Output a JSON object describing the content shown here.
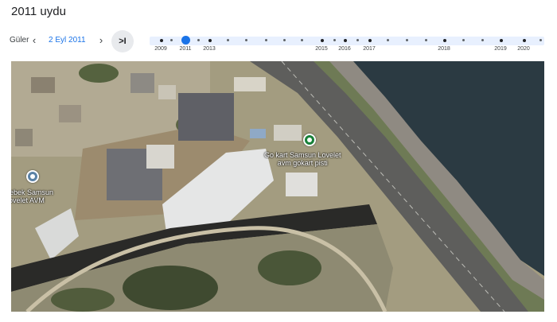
{
  "page": {
    "title": "2011 uydu"
  },
  "toolbar": {
    "cut_label": "Güler",
    "prev_icon": "‹",
    "date": "2 Eyl 2011",
    "next_icon": "›",
    "latest_icon": ">I"
  },
  "timeline": {
    "years": [
      "2009",
      "2011",
      "2013",
      "2015",
      "2016",
      "2017",
      "2018",
      "2019",
      "2020"
    ],
    "selected_year": "2011"
  },
  "map": {
    "pois": [
      {
        "id": "gokart",
        "line1": "Go kart Samsun Lovelet",
        "line2": "avm gokart pisti",
        "icon": "pin-icon",
        "color": "#188038"
      },
      {
        "id": "bebek",
        "line1": "Bebek Samsun",
        "line2": "Lovelet AVM",
        "icon": "pin-icon",
        "color": "#5b82a6"
      }
    ]
  }
}
